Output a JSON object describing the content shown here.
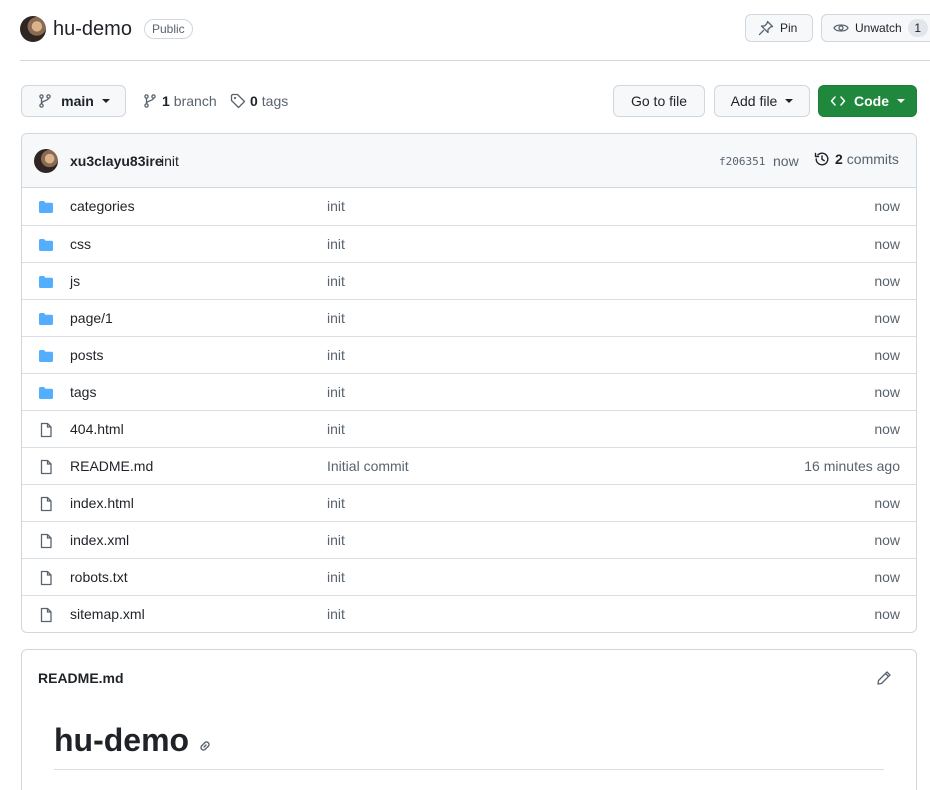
{
  "repo": {
    "name": "hu-demo",
    "visibility": "Public",
    "pin_label": "Pin",
    "watch_label": "Unwatch",
    "watch_count": "1"
  },
  "toolbar": {
    "branch": "main",
    "branch_count": "1",
    "branch_word": "branch",
    "tag_count": "0",
    "tag_word": "tags",
    "goto_label": "Go to file",
    "addfile_label": "Add file",
    "code_label": "Code"
  },
  "commit": {
    "author": "xu3clayu83ire",
    "message": "init",
    "sha": "f206351",
    "time": "now",
    "count": "2",
    "count_word": "commits"
  },
  "files": [
    {
      "type": "folder",
      "name": "categories",
      "message": "init",
      "age": "now"
    },
    {
      "type": "folder",
      "name": "css",
      "message": "init",
      "age": "now"
    },
    {
      "type": "folder",
      "name": "js",
      "message": "init",
      "age": "now"
    },
    {
      "type": "folder",
      "name": "page/1",
      "message": "init",
      "age": "now"
    },
    {
      "type": "folder",
      "name": "posts",
      "message": "init",
      "age": "now"
    },
    {
      "type": "folder",
      "name": "tags",
      "message": "init",
      "age": "now"
    },
    {
      "type": "file",
      "name": "404.html",
      "message": "init",
      "age": "now"
    },
    {
      "type": "file",
      "name": "README.md",
      "message": "Initial commit",
      "age": "16 minutes ago"
    },
    {
      "type": "file",
      "name": "index.html",
      "message": "init",
      "age": "now"
    },
    {
      "type": "file",
      "name": "index.xml",
      "message": "init",
      "age": "now"
    },
    {
      "type": "file",
      "name": "robots.txt",
      "message": "init",
      "age": "now"
    },
    {
      "type": "file",
      "name": "sitemap.xml",
      "message": "init",
      "age": "now"
    }
  ],
  "readme": {
    "title": "README.md",
    "heading": "hu-demo"
  },
  "colors": {
    "folder": "#54aeff",
    "file": "#59636e",
    "code_button": "#1f883d"
  }
}
